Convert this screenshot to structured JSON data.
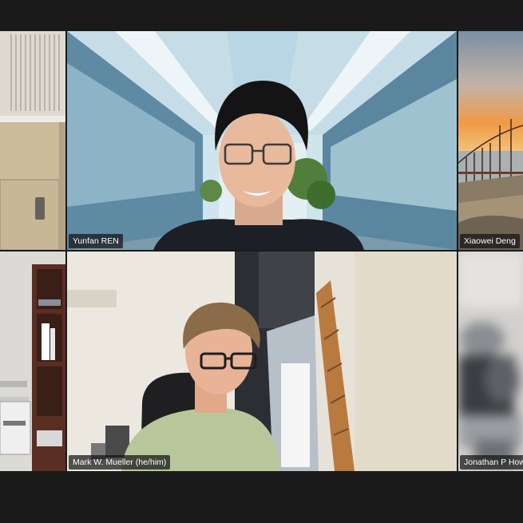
{
  "window": {
    "background": "#1a1a1a",
    "active_speaker_border": "#2ac152"
  },
  "participants": [
    {
      "name": "",
      "position": "top-left",
      "video": "office-cabinet"
    },
    {
      "name": "Yunfan REN",
      "position": "top-center",
      "video": "virtual-background-atrium"
    },
    {
      "name": "Xiaowei Deng",
      "position": "top-right",
      "video": "golden-gate-sunset"
    },
    {
      "name": "",
      "position": "bottom-left",
      "video": "office-shelf-printer",
      "active_speaker": true
    },
    {
      "name": "Mark W. Mueller (he/him)",
      "position": "bottom-center",
      "video": "office-window"
    },
    {
      "name": "Jonathan P How",
      "position": "bottom-right",
      "video": "blurred"
    }
  ]
}
